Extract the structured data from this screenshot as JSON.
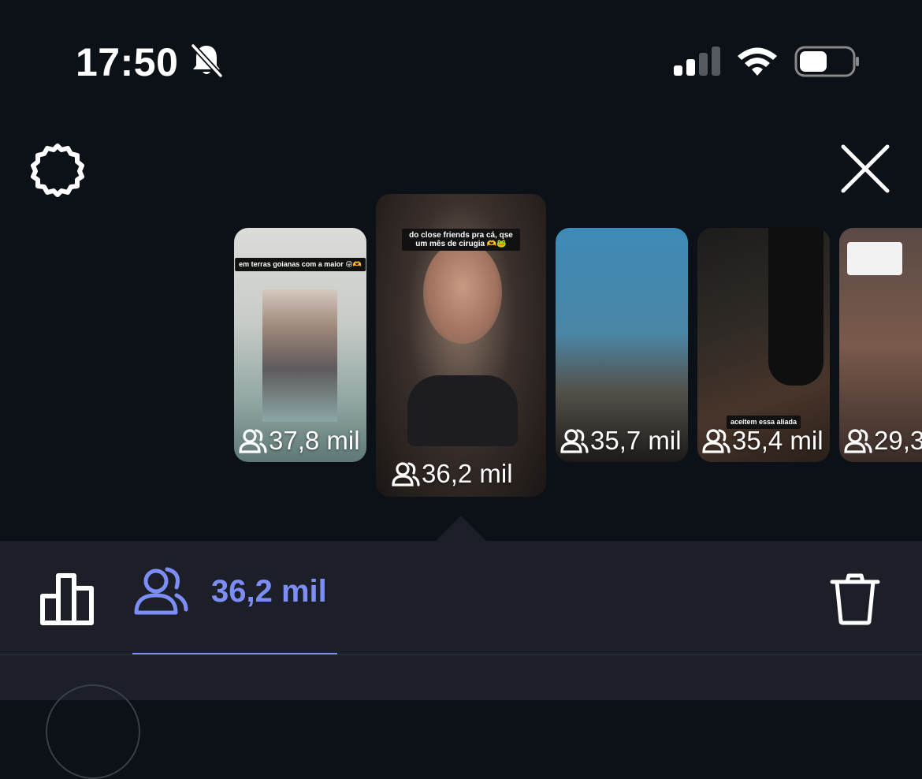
{
  "status_bar": {
    "time": "17:50",
    "icons": [
      "bell-muted-icon",
      "cellular-signal-icon",
      "wifi-icon",
      "battery-icon"
    ]
  },
  "top_bar": {
    "icons": [
      "settings-icon",
      "close-icon"
    ]
  },
  "stories": [
    {
      "views": "37,8 mil",
      "caption": "em terras goianas com a maior 😜🫶",
      "active": false
    },
    {
      "views": "36,2 mil",
      "caption": "do close friends pra cá, qse um mês de cirugia 🫶🐸",
      "active": true
    },
    {
      "views": "35,7 mil",
      "caption": "",
      "active": false
    },
    {
      "views": "35,4 mil",
      "caption": "aceitem essa aliada",
      "active": false
    },
    {
      "views": "29,3",
      "caption": "",
      "active": false
    }
  ],
  "panel": {
    "viewer_count": "36,2 mil",
    "icons": [
      "bar-chart-icon",
      "viewers-icon",
      "trash-icon"
    ]
  },
  "colors": {
    "background": "#0c1117",
    "panel": "#1c1f27",
    "accent": "#7c8ef5"
  }
}
